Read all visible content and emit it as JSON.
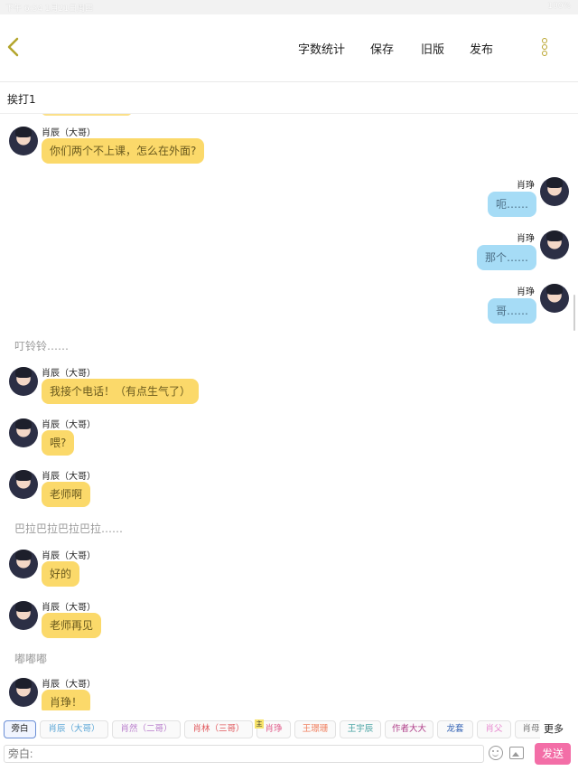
{
  "status": {
    "time_date": "下午 6:54   1月21日周四",
    "battery": "100%"
  },
  "navbar": {
    "actions": [
      "字数统计",
      "保存",
      "旧版",
      "发布"
    ]
  },
  "chapter": {
    "title": "挨打1"
  },
  "messages": [
    {
      "side": "left",
      "name": "肖辰（大哥）",
      "text": "你们两个不上课，怎么在外面?"
    },
    {
      "side": "right",
      "name": "肖琤",
      "text": "呃……"
    },
    {
      "side": "right",
      "name": "肖琤",
      "text": "那个……"
    },
    {
      "side": "right",
      "name": "肖琤",
      "text": "哥……"
    },
    {
      "side": "narration",
      "text": "叮铃铃……"
    },
    {
      "side": "left",
      "name": "肖辰（大哥）",
      "text": "我接个电话！（有点生气了）"
    },
    {
      "side": "left",
      "name": "肖辰（大哥）",
      "text": "喂?"
    },
    {
      "side": "left",
      "name": "肖辰（大哥）",
      "text": "老师啊"
    },
    {
      "side": "narration",
      "text": "巴拉巴拉巴拉巴拉……"
    },
    {
      "side": "left",
      "name": "肖辰（大哥）",
      "text": "好的"
    },
    {
      "side": "left",
      "name": "肖辰（大哥）",
      "text": "老师再见"
    },
    {
      "side": "narration",
      "text": "嘟嘟嘟"
    },
    {
      "side": "left",
      "name": "肖辰（大哥）",
      "text": "肖琤！"
    }
  ],
  "roles": [
    {
      "label": "旁白",
      "color": "#222222"
    },
    {
      "label": "肖辰（大哥）",
      "color": "#5aa6d6"
    },
    {
      "label": "肖然（二哥）",
      "color": "#b77acb"
    },
    {
      "label": "肖林（三哥）",
      "color": "#e0565b"
    },
    {
      "label": "肖琤",
      "color": "#e05c8a"
    },
    {
      "label": "王璟珊",
      "color": "#f07f5e"
    },
    {
      "label": "王宇辰",
      "color": "#48a3a3"
    },
    {
      "label": "作者大大",
      "color": "#b0408a"
    },
    {
      "label": "龙套",
      "color": "#2f5fb3"
    },
    {
      "label": "肖父",
      "color": "#e88bd0"
    },
    {
      "label": "肖母",
      "color": "#777777"
    }
  ],
  "roles_more": "更多",
  "role_badge": "主",
  "input": {
    "placeholder": "旁白:"
  },
  "send_label": "发送"
}
